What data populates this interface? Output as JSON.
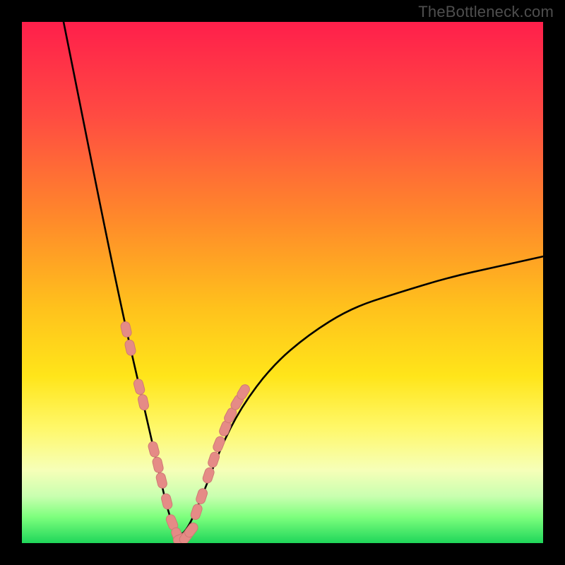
{
  "watermark": "TheBottleneck.com",
  "colors": {
    "frame": "#000000",
    "curve": "#000000",
    "marker_fill": "#e58b86",
    "marker_stroke": "#cf7a74",
    "gradient_top": "#ff1f4b",
    "gradient_bottom": "#1fd65a"
  },
  "chart_data": {
    "type": "line",
    "title": "",
    "xlabel": "",
    "ylabel": "",
    "xlim": [
      0,
      100
    ],
    "ylim": [
      0,
      100
    ],
    "curve": {
      "comment": "V-shaped bottleneck curve; minimum near x≈30, y≈0. Left branch descends steeply from top-left; right branch rises to roughly y≈55 at x=100.",
      "x": [
        8,
        12,
        16,
        20,
        23,
        26,
        28,
        30,
        32,
        35,
        38,
        42,
        48,
        55,
        63,
        72,
        82,
        91,
        100
      ],
      "y": [
        100,
        80,
        60,
        41,
        28,
        15,
        6,
        1,
        3,
        10,
        18,
        26,
        34,
        40,
        45,
        48,
        51,
        53,
        55
      ]
    },
    "series": [
      {
        "name": "left-branch-markers",
        "type": "scatter",
        "x": [
          20.0,
          20.8,
          22.5,
          23.3,
          25.3,
          26.1,
          26.8,
          27.8,
          28.8,
          29.8
        ],
        "y": [
          41.0,
          37.5,
          30.0,
          27.0,
          18.0,
          15.0,
          12.0,
          8.0,
          4.0,
          1.5
        ]
      },
      {
        "name": "valley-markers",
        "type": "scatter",
        "x": [
          30.5,
          31.5,
          32.5
        ],
        "y": [
          0.8,
          1.2,
          2.5
        ]
      },
      {
        "name": "right-branch-markers",
        "type": "scatter",
        "x": [
          33.5,
          34.5,
          35.8,
          36.8,
          37.8,
          39.0,
          40.0,
          41.3,
          42.5
        ],
        "y": [
          6.0,
          9.0,
          13.0,
          16.0,
          19.0,
          22.0,
          24.5,
          27.0,
          29.0
        ]
      }
    ]
  }
}
